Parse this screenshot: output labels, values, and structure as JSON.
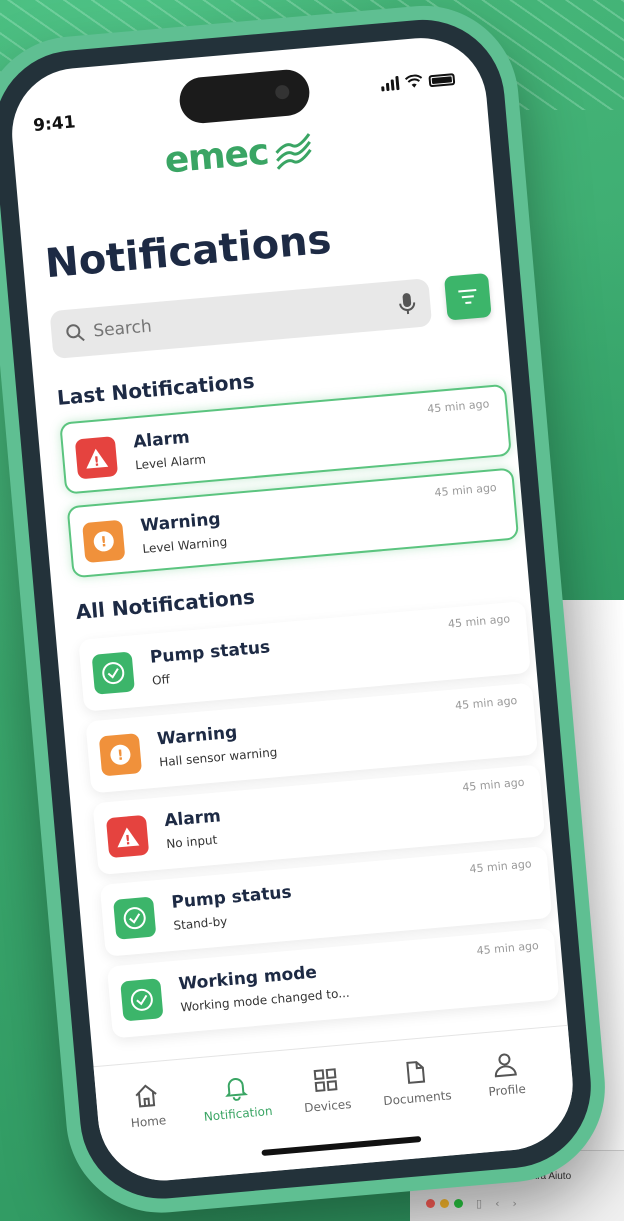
{
  "status_bar": {
    "time": "9:41"
  },
  "logo": {
    "text": "emec"
  },
  "page": {
    "title": "Notifications"
  },
  "search": {
    "placeholder": "Search"
  },
  "sections": {
    "last_title": "Last Notifications",
    "all_title": "All Notifications"
  },
  "last_notifications": [
    {
      "title": "Alarm",
      "subtitle": "Level Alarm",
      "time": "45 min ago",
      "kind": "alarm"
    },
    {
      "title": "Warning",
      "subtitle": "Level Warning",
      "time": "45 min ago",
      "kind": "warning"
    }
  ],
  "all_notifications": [
    {
      "title": "Pump status",
      "subtitle": "Off",
      "time": "45 min ago",
      "kind": "ok"
    },
    {
      "title": "Warning",
      "subtitle": "Hall sensor warning",
      "time": "45 min ago",
      "kind": "warning"
    },
    {
      "title": "Alarm",
      "subtitle": "No input",
      "time": "45 min ago",
      "kind": "alarm"
    },
    {
      "title": "Pump status",
      "subtitle": "Stand-by",
      "time": "45 min ago",
      "kind": "ok"
    },
    {
      "title": "Working mode",
      "subtitle": "Working mode changed to...",
      "time": "45 min ago",
      "kind": "ok"
    }
  ],
  "tabs": [
    {
      "label": "Home",
      "icon": "home-icon",
      "active": false
    },
    {
      "label": "Notification",
      "icon": "bell-icon",
      "active": true
    },
    {
      "label": "Devices",
      "icon": "grid-icon",
      "active": false
    },
    {
      "label": "Documents",
      "icon": "document-icon",
      "active": false
    },
    {
      "label": "Profile",
      "icon": "user-icon",
      "active": false
    }
  ],
  "desktop": {
    "menu_text": "Finestra   Aiuto"
  },
  "colors": {
    "brand_green": "#3aa564",
    "alarm_red": "#e5433f",
    "warning_orange": "#f0913b",
    "ok_green": "#3cb56a",
    "heading_navy": "#1d2a44"
  }
}
